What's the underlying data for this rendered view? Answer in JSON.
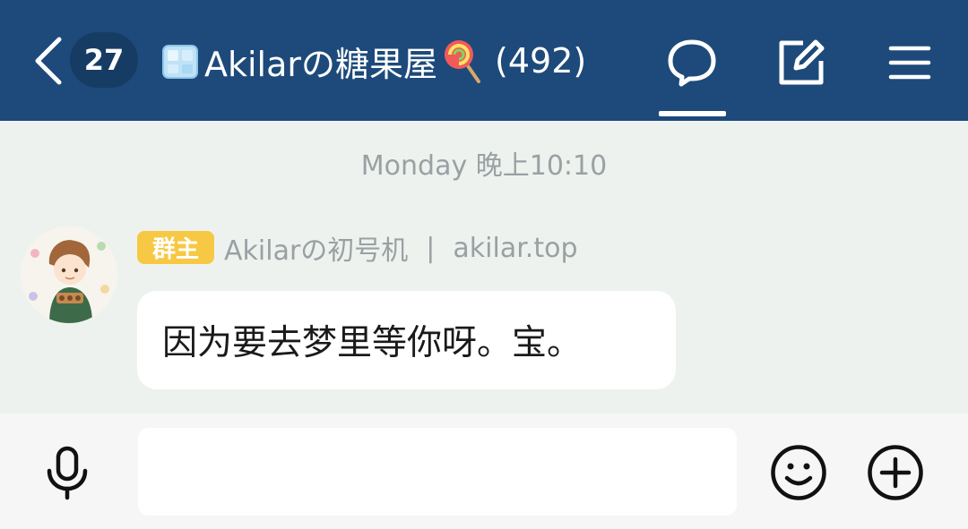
{
  "header": {
    "unread_count": "27",
    "title_name": "Akilarの糖果屋",
    "title_count": "(492)",
    "title_icon_left": "ice-cube-icon",
    "title_icon_right": "lollipop-icon",
    "active_tab": "chat",
    "bg_color": "#1d4a7a"
  },
  "timestamp": "Monday 晚上10:10",
  "message": {
    "role_badge": "群主",
    "sender_name": "Akilarの初号机",
    "separator": "|",
    "sender_site": "akilar.top",
    "text": "因为要去梦里等你呀。宝。",
    "badge_color": "#f7c843"
  },
  "input": {
    "value": "",
    "placeholder": ""
  },
  "icons": {
    "back": "chevron-left-icon",
    "chat": "chat-bubble-icon",
    "edit": "edit-icon",
    "menu": "menu-icon",
    "mic": "microphone-icon",
    "emoji": "smiley-icon",
    "plus": "plus-circle-icon"
  }
}
